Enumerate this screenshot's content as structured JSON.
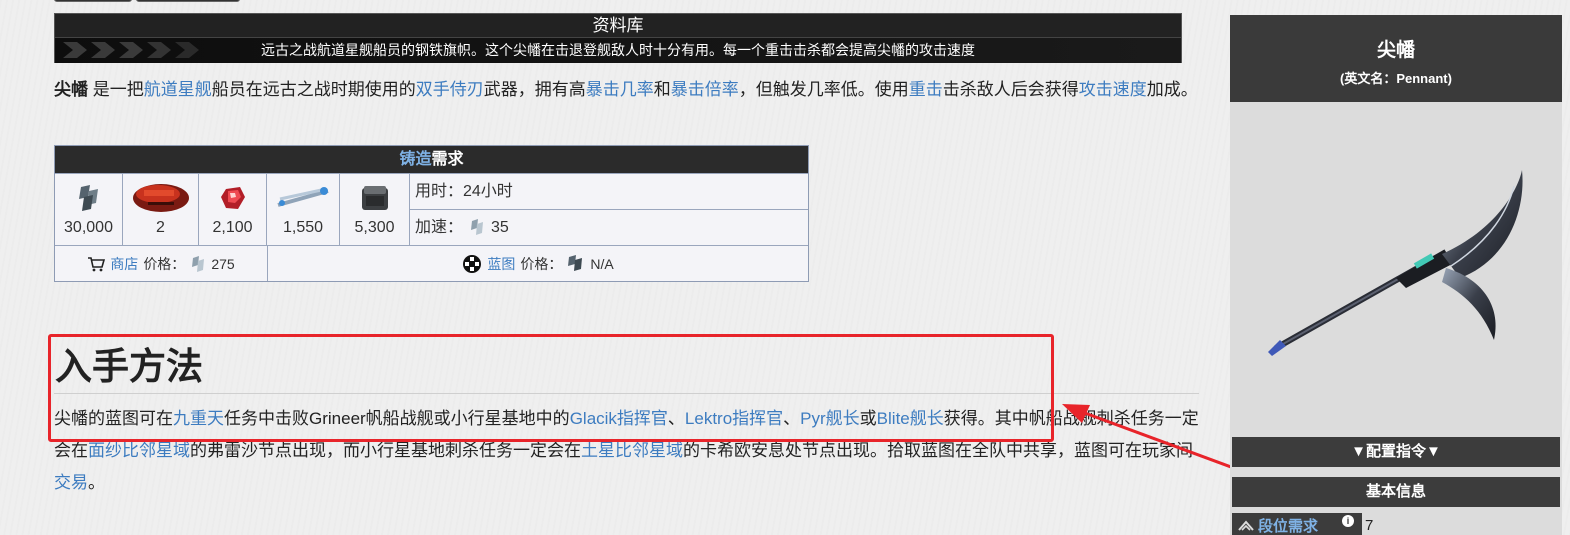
{
  "codex": {
    "title": "资料库",
    "subtitle": "远古之战航道星舰船员的钢铁旗帜。这个尖幡在击退登舰敌人时十分有用。每一个重击击杀都会提高尖幡的攻击速度"
  },
  "intro": {
    "name": "尖幡",
    "t1": " 是一把",
    "l1": "航道星舰",
    "t2": "船员在远古之战时期使用的",
    "l2": "双手侍刃",
    "t3": "武器，拥有高",
    "l3": "暴击几率",
    "t4": "和",
    "l4": "暴击倍率",
    "t5": "，但触发几率低。使用",
    "l5": "重击",
    "t6": "击杀敌人后会获得",
    "l6": "攻击速度",
    "t7": "加成。"
  },
  "craft": {
    "head_link": "铸造",
    "head_text": "需求",
    "resources": [
      {
        "icon": "credits-icon",
        "amount": "30,000"
      },
      {
        "icon": "red-crate-icon",
        "amount": "2"
      },
      {
        "icon": "red-gem-icon",
        "amount": "2,100"
      },
      {
        "icon": "blue-cable-icon",
        "amount": "1,550"
      },
      {
        "icon": "gray-block-icon",
        "amount": "5,300"
      }
    ],
    "time_label": "用时：24小时",
    "rush_label": "加速：",
    "rush_value": "35",
    "shop_link": "商店",
    "shop_label": "价格：",
    "shop_value": "275",
    "bp_link": "蓝图",
    "bp_label": "价格：",
    "bp_value": "N/A"
  },
  "acquire": {
    "title": "入手方法",
    "p1": "尖幡的蓝图可在",
    "l1": "九重天",
    "p2": "任务中击败Grineer帆船战舰或小行星基地中的",
    "l2": "Glacik指挥官",
    "p3": "、",
    "l3": "Lektro指挥官",
    "p4": "、",
    "l4": "Pyr舰长",
    "p5": "或",
    "l5": "Blite舰长",
    "p6": "获得。其中帆船战舰刺杀任务一定会在",
    "l6": "面纱比邻星域",
    "p7": "的弗雷沙节点出现，而小行星基地刺杀任务一定会在",
    "l7": "土星比邻星域",
    "p8": "的卡希欧安息处节点出现。拾取蓝图在全队中共享，蓝图可在玩家间",
    "l8": "交易",
    "p9": "。"
  },
  "infobox": {
    "name": "尖幡",
    "english": "(英文名：Pennant)",
    "config_bar": "▼配置指令▼",
    "basic_bar": "基本信息",
    "mastery_label": "段位需求",
    "mastery_value": "7"
  },
  "colors": {
    "link": "#3d7cc0",
    "highlight_box": "#e8242a",
    "header_dark": "#2b2b2b"
  }
}
